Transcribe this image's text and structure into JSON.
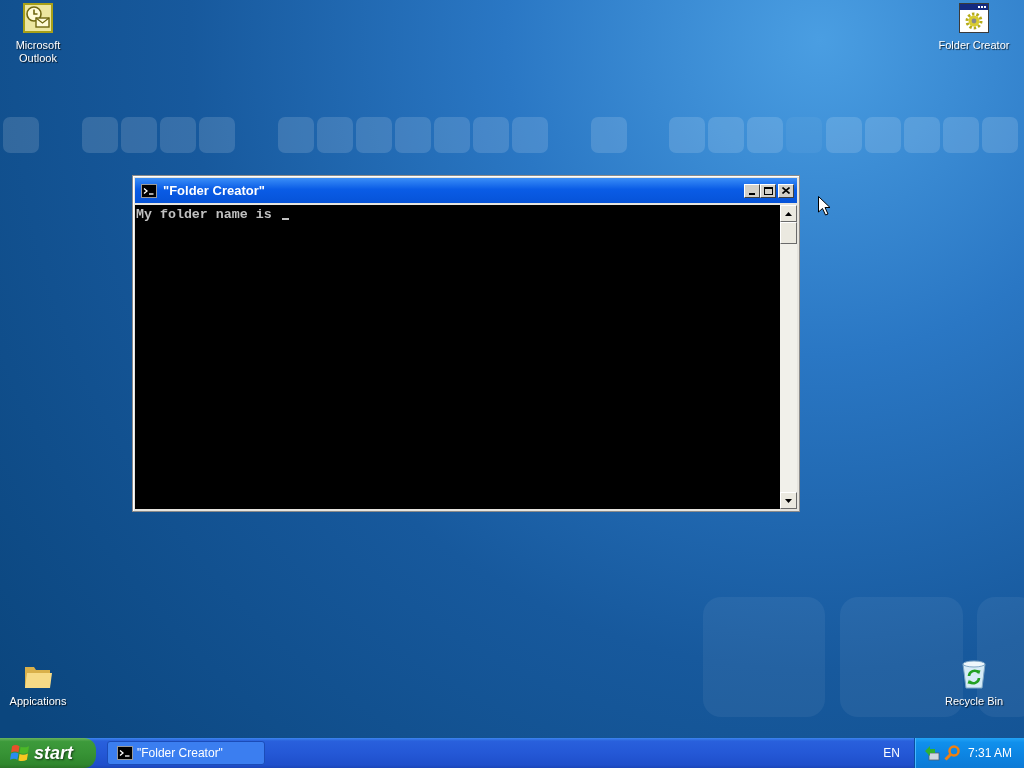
{
  "desktop": {
    "left_icons": [
      {
        "label": "Microsoft Outlook",
        "kind": "outlook"
      },
      {
        "label": "Appications",
        "kind": "folder"
      }
    ],
    "right_icons": [
      {
        "label": "Folder Creator",
        "kind": "program"
      },
      {
        "label": "Recycle Bin",
        "kind": "recycle-bin"
      }
    ]
  },
  "window": {
    "title": "\"Folder Creator\"",
    "console_text": "My folder name is"
  },
  "taskbar": {
    "start_label": "start",
    "tasks": [
      {
        "label": "\"Folder Creator\"",
        "selected": false
      }
    ],
    "language": "EN",
    "clock": "7:31 AM"
  }
}
